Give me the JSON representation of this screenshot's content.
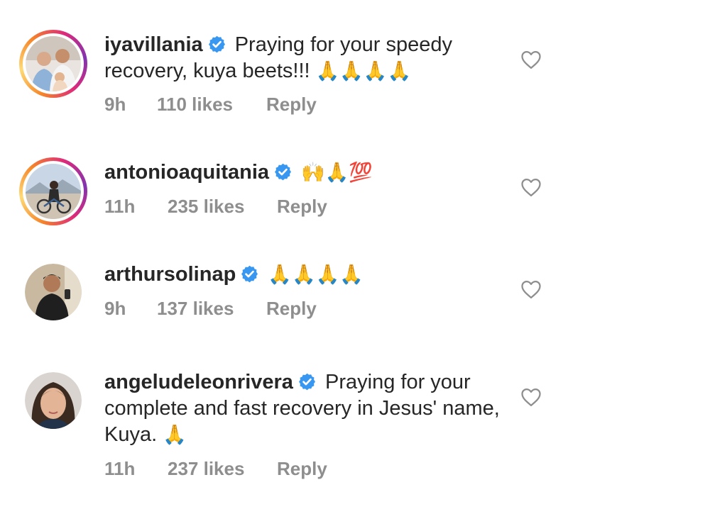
{
  "comments": [
    {
      "username": "iyavillania",
      "text": "Praying for your speedy recovery, kuya beets!!!",
      "emoji": "🙏🙏🙏🙏",
      "time": "9h",
      "likes": "110 likes",
      "reply": "Reply",
      "verified": true,
      "story_ring": true
    },
    {
      "username": "antonioaquitania",
      "text": "",
      "emoji": "🙌🙏💯",
      "time": "11h",
      "likes": "235 likes",
      "reply": "Reply",
      "verified": true,
      "story_ring": true
    },
    {
      "username": "arthursolinap",
      "text": "",
      "emoji": "🙏🙏🙏🙏",
      "time": "9h",
      "likes": "137 likes",
      "reply": "Reply",
      "verified": true,
      "story_ring": false
    },
    {
      "username": "angeludeleonrivera",
      "text": "Praying for your complete and fast recovery in Jesus' name, Kuya.",
      "emoji": "🙏",
      "time": "11h",
      "likes": "237 likes",
      "reply": "Reply",
      "verified": true,
      "story_ring": false
    }
  ],
  "colors": {
    "text": "#262626",
    "meta": "#8e8e8e",
    "verified": "#3897f0"
  },
  "icons": {
    "verified": "verified-badge-icon",
    "like": "heart-outline-icon"
  }
}
